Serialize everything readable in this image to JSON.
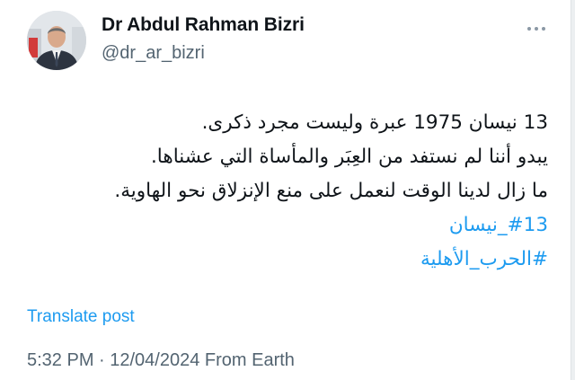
{
  "author": {
    "name": "Dr Abdul Rahman Bizri",
    "handle": "@dr_ar_bizri"
  },
  "tweet": {
    "lines": [
      "13 نيسان 1975 عبرة وليست مجرد ذكرى.",
      "يبدو أننا لم نستفد من العِبَر والمأساة التي عشناها.",
      "ما زال لدينا الوقت لنعمل على منع الإنزلاق نحو الهاوية."
    ],
    "hashtags": [
      "#13_نيسان",
      "#الحرب_الأهلية"
    ]
  },
  "translate_label": "Translate post",
  "meta_text": "5:32 PM · 12/04/2024 From Earth",
  "icons": {
    "more": "more-horizontal-icon",
    "avatar": "profile-photo"
  },
  "colors": {
    "link": "#1d9bf0",
    "text": "#0f1419",
    "secondary": "#536471"
  }
}
